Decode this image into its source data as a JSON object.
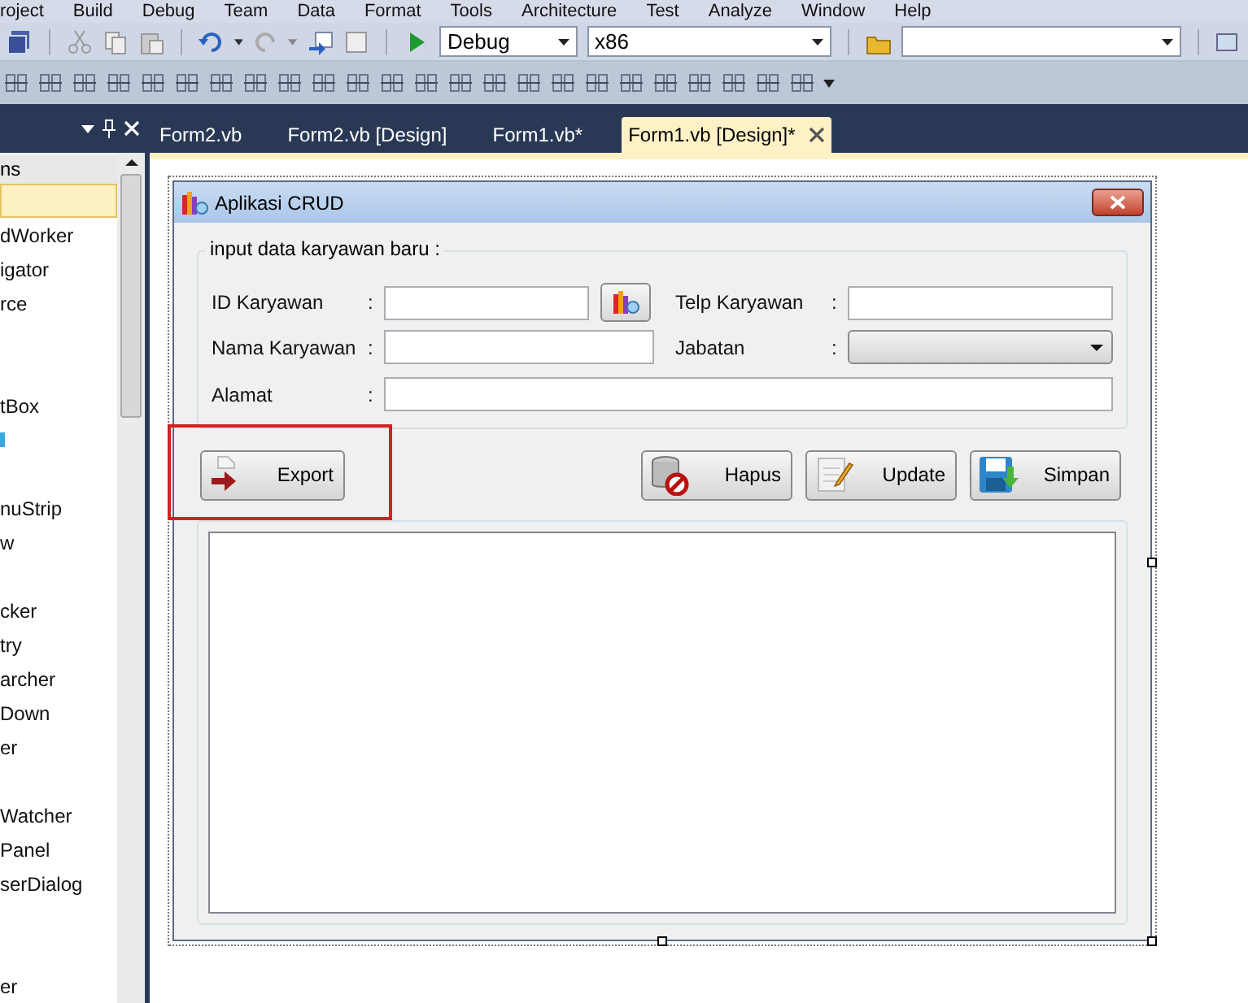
{
  "menu": [
    "roject",
    "Build",
    "Debug",
    "Team",
    "Data",
    "Format",
    "Tools",
    "Architecture",
    "Test",
    "Analyze",
    "Window",
    "Help"
  ],
  "toolbar": {
    "configuration": "Debug",
    "platform": "x86"
  },
  "tabs": [
    {
      "label": "Form2.vb",
      "selected": false
    },
    {
      "label": "Form2.vb [Design]",
      "selected": false
    },
    {
      "label": "Form1.vb*",
      "selected": false
    },
    {
      "label": "Form1.vb [Design]*",
      "selected": true
    }
  ],
  "toolbox": {
    "header": "ns",
    "items": [
      {
        "kind": "text",
        "selected": true
      },
      {
        "kind": "text",
        "label": "dWorker",
        "selected": false
      },
      {
        "kind": "text",
        "label": "igator",
        "selected": false
      },
      {
        "kind": "text",
        "label": "rce",
        "selected": false
      },
      {
        "kind": "blank",
        "selected": false
      },
      {
        "kind": "blank",
        "selected": false
      },
      {
        "kind": "text",
        "label": "tBox",
        "selected": false
      },
      {
        "kind": "icon",
        "selected": false
      },
      {
        "kind": "blank",
        "selected": false
      },
      {
        "kind": "text",
        "label": "nuStrip",
        "selected": false
      },
      {
        "kind": "text",
        "label": "w",
        "selected": false
      },
      {
        "kind": "blank",
        "selected": false
      },
      {
        "kind": "text",
        "label": "cker",
        "selected": false
      },
      {
        "kind": "text",
        "label": "try",
        "selected": false
      },
      {
        "kind": "text",
        "label": "archer",
        "selected": false
      },
      {
        "kind": "text",
        "label": "Down",
        "selected": false
      },
      {
        "kind": "text",
        "label": "er",
        "selected": false
      },
      {
        "kind": "blank",
        "selected": false
      },
      {
        "kind": "text",
        "label": "Watcher",
        "selected": false
      },
      {
        "kind": "text",
        "label": "Panel",
        "selected": false
      },
      {
        "kind": "text",
        "label": "serDialog",
        "selected": false
      },
      {
        "kind": "blank",
        "selected": false
      },
      {
        "kind": "blank",
        "selected": false
      },
      {
        "kind": "text",
        "label": "er",
        "selected": false
      }
    ]
  },
  "form": {
    "title": "Aplikasi CRUD",
    "group_title": "input data karyawan baru :",
    "fields": [
      {
        "label": "ID Karyawan",
        "separator": ":",
        "kind": "lookup"
      },
      {
        "label": "Telp Karyawan",
        "separator": ":",
        "kind": "text"
      },
      {
        "label": "Nama Karyawan",
        "separator": ":",
        "kind": "text"
      },
      {
        "label": "Jabatan",
        "separator": ":",
        "kind": "combo"
      },
      {
        "label": "Alamat",
        "separator": ":",
        "kind": "text"
      }
    ],
    "buttons": [
      {
        "label": "Export",
        "kind": "export",
        "annotated": true
      },
      {
        "label": "Hapus",
        "kind": "delete",
        "annotated": false
      },
      {
        "label": "Update",
        "kind": "update",
        "annotated": false
      },
      {
        "label": "Simpan",
        "kind": "save",
        "annotated": false
      }
    ]
  }
}
